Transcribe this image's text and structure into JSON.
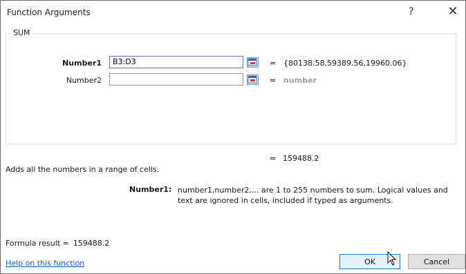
{
  "dialog": {
    "title": "Function Arguments",
    "help_glyph": "?",
    "close_glyph": "✕"
  },
  "function_group": {
    "name": "SUM",
    "arguments": [
      {
        "label": "Number1",
        "value": "B3:D3",
        "evaluated": "{80138.58,59389.56,19960.06}",
        "equals": "="
      },
      {
        "label": "Number2",
        "value": "",
        "evaluated": "number",
        "equals": "="
      }
    ],
    "result_equals": "=",
    "result": "159488.2"
  },
  "description": {
    "function_summary": "Adds all the numbers in a range of cells.",
    "arg_label": "Number1:",
    "arg_text": "number1,number2,... are 1 to 255 numbers to sum. Logical values and text are ignored in cells, included if typed as arguments."
  },
  "footer": {
    "formula_result_label": "Formula result =",
    "formula_result_value": "159488.2",
    "help_link": "Help on this function",
    "ok_label": "OK",
    "cancel_label": "Cancel"
  },
  "colors": {
    "link": "#1a5fb4",
    "ok_border": "#0078d7",
    "hint_text": "#a0a0a0"
  }
}
